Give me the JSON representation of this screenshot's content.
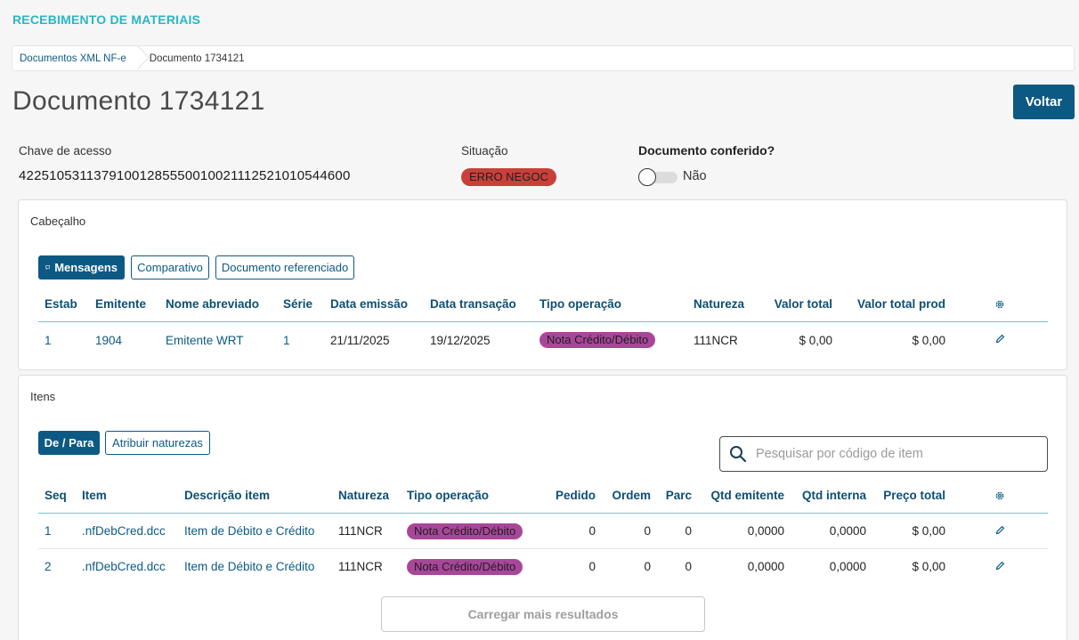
{
  "app": {
    "title": "RECEBIMENTO DE MATERIAIS"
  },
  "breadcrumb": {
    "items": [
      "Documentos XML NF-e",
      "Documento 1734121"
    ]
  },
  "page": {
    "title": "Documento 1734121",
    "back_button": "Voltar"
  },
  "summary": {
    "chave_label": "Chave de acesso",
    "chave_value": "42251053113791001285550010021112521010544600",
    "situacao_label": "Situação",
    "situacao_value": "ERRO NEGOC",
    "conferido_label": "Documento conferido?",
    "conferido_value": "Não",
    "conferido_checked": false
  },
  "cabecalho": {
    "title": "Cabeçalho",
    "buttons": [
      "Mensagens",
      "Comparativo",
      "Documento referenciado"
    ],
    "columns": [
      "Estab",
      "Emitente",
      "Nome abreviado",
      "Série",
      "Data emissão",
      "Data transação",
      "Tipo operação",
      "Natureza",
      "Valor total",
      "Valor total prod"
    ],
    "rows": [
      {
        "estab": "1",
        "emitente": "1904",
        "nome_abreviado": "Emitente WRT",
        "serie": "1",
        "data_emissao": "21/11/2025",
        "data_transacao": "19/12/2025",
        "tipo_operacao": "Nota Crédito/Débito",
        "natureza": "111NCR",
        "valor_total": "$ 0,00",
        "valor_total_prod": "$ 0,00"
      }
    ]
  },
  "itens": {
    "title": "Itens",
    "buttons": [
      "De / Para",
      "Atribuir naturezas"
    ],
    "search_placeholder": "Pesquisar por código de item",
    "columns": [
      "Seq",
      "Item",
      "Descrição item",
      "Natureza",
      "Tipo operação",
      "Pedido",
      "Ordem",
      "Parc",
      "Qtd emitente",
      "Qtd interna",
      "Preço total"
    ],
    "rows": [
      {
        "seq": "1",
        "item": ".nfDebCred.dcc",
        "descricao": "Item de Débito e Crédito",
        "natureza": "111NCR",
        "tipo_operacao": "Nota Crédito/Débito",
        "pedido": "0",
        "ordem": "0",
        "parc": "0",
        "qtd_emitente": "0,0000",
        "qtd_interna": "0,0000",
        "preco_total": "$ 0,00"
      },
      {
        "seq": "2",
        "item": ".nfDebCred.dcc",
        "descricao": "Item de Débito e Crédito",
        "natureza": "111NCR",
        "tipo_operacao": "Nota Crédito/Débito",
        "pedido": "0",
        "ordem": "0",
        "parc": "0",
        "qtd_emitente": "0,0000",
        "qtd_interna": "0,0000",
        "preco_total": "$ 0,00"
      }
    ],
    "load_more": "Carregar mais resultados"
  },
  "colors": {
    "primary": "#0c5a84",
    "accent_title": "#29b6c6",
    "status_error": "#c9403a",
    "op_badge": "#a8479a",
    "row_line": "#6cc3c9"
  },
  "icons": {
    "message": "message-icon",
    "settings": "gear-icon",
    "edit": "pencil-icon",
    "search": "search-icon"
  }
}
